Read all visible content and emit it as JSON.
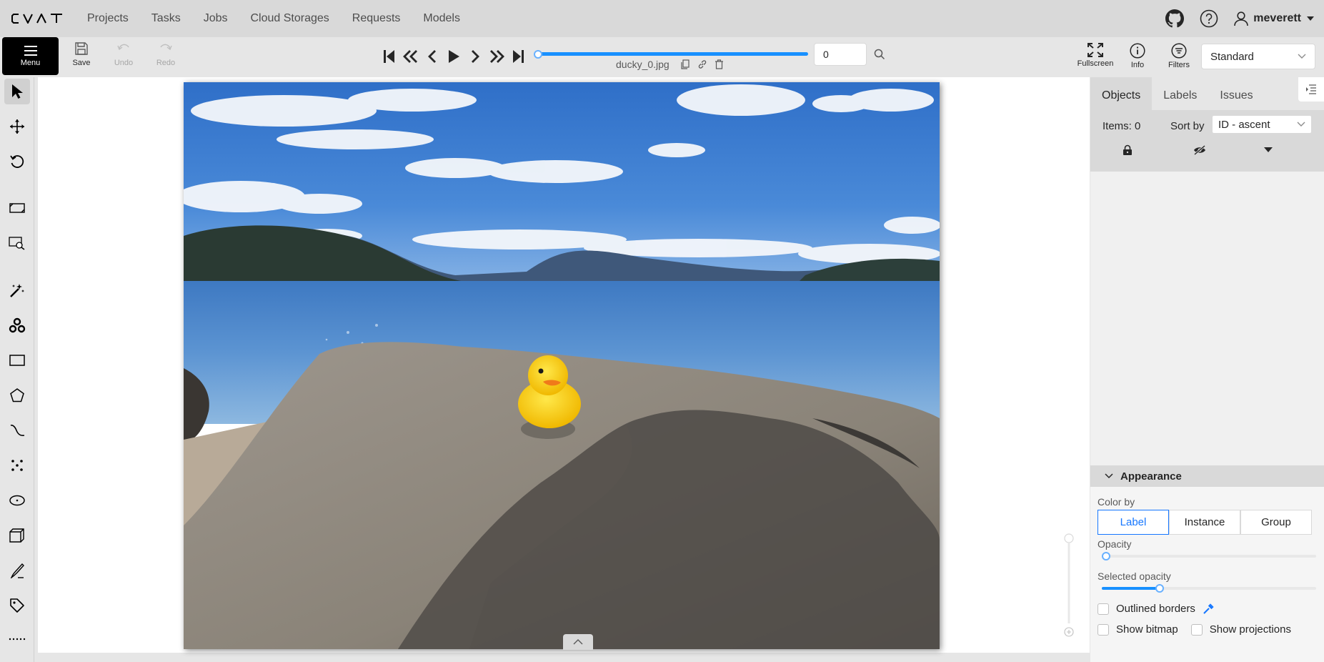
{
  "app": {
    "logo": "CVAT"
  },
  "nav": [
    "Projects",
    "Tasks",
    "Jobs",
    "Cloud Storages",
    "Requests",
    "Models"
  ],
  "user": {
    "name": "meverett"
  },
  "toolbar": {
    "menu_label": "Menu",
    "save_label": "Save",
    "undo_label": "Undo",
    "redo_label": "Redo",
    "frame_filename": "ducky_0.jpg",
    "frame_number": "0",
    "frame_progress": 0,
    "fullscreen_label": "Fullscreen",
    "info_label": "Info",
    "filters_label": "Filters",
    "workspace": "Standard"
  },
  "left_tools": [
    "cursor",
    "move",
    "rotate",
    "fit",
    "zoom-region",
    "magic-wand",
    "openvino",
    "rectangle",
    "polygon",
    "polyline",
    "points",
    "ellipse",
    "cuboid",
    "brush",
    "tag",
    "more"
  ],
  "right_panel": {
    "tabs": [
      "Objects",
      "Labels",
      "Issues"
    ],
    "active_tab": "Objects",
    "items_label": "Items: 0",
    "sort_label": "Sort by",
    "sort_value": "ID - ascent"
  },
  "appearance": {
    "title": "Appearance",
    "color_by_label": "Color by",
    "color_by_options": [
      "Label",
      "Instance",
      "Group"
    ],
    "color_by_selected": "Label",
    "opacity_label": "Opacity",
    "opacity_value": 0,
    "selected_opacity_label": "Selected opacity",
    "selected_opacity_value": 0.26,
    "outlined_borders_label": "Outlined borders",
    "show_bitmap_label": "Show bitmap",
    "show_projections_label": "Show projections"
  },
  "colors": {
    "accent": "#1677ff",
    "slider": "#1890ff",
    "sky": "#3b7fd4",
    "duck": "#f5c800"
  }
}
